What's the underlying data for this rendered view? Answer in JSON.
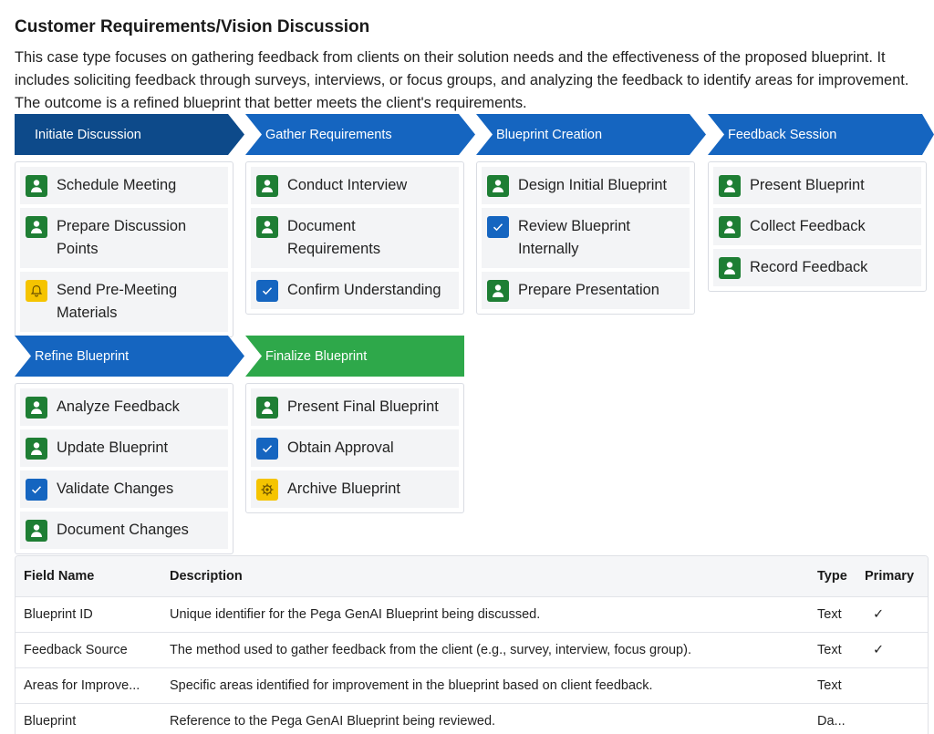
{
  "page": {
    "title": "Customer Requirements/Vision Discussion",
    "description": "This case type focuses on gathering feedback from clients on their solution needs and the effectiveness of the proposed blueprint. It includes soliciting feedback through surveys, interviews, or focus groups, and analyzing the feedback to identify areas for improvement. The outcome is a refined blueprint that better meets the client's requirements."
  },
  "stages": [
    {
      "label": "Initiate Discussion",
      "color": "#0d4a8a",
      "tasks": [
        {
          "icon": "person-icon",
          "label": "Schedule Meeting"
        },
        {
          "icon": "person-icon",
          "label": "Prepare Discussion Points"
        },
        {
          "icon": "bell-icon",
          "label": "Send Pre-Meeting Materials"
        }
      ]
    },
    {
      "label": "Gather Requirements",
      "color": "#1565c0",
      "tasks": [
        {
          "icon": "person-icon",
          "label": "Conduct Interview"
        },
        {
          "icon": "person-icon",
          "label": "Document Requirements"
        },
        {
          "icon": "check-icon",
          "label": "Confirm Understanding"
        }
      ]
    },
    {
      "label": "Blueprint Creation",
      "color": "#1565c0",
      "tasks": [
        {
          "icon": "person-icon",
          "label": "Design Initial Blueprint"
        },
        {
          "icon": "check-icon",
          "label": "Review Blueprint Internally"
        },
        {
          "icon": "person-icon",
          "label": "Prepare Presentation"
        }
      ]
    },
    {
      "label": "Feedback Session",
      "color": "#1565c0",
      "tasks": [
        {
          "icon": "person-icon",
          "label": "Present Blueprint"
        },
        {
          "icon": "person-icon",
          "label": "Collect Feedback"
        },
        {
          "icon": "person-icon",
          "label": "Record Feedback"
        }
      ]
    },
    {
      "label": "Refine Blueprint",
      "color": "#1565c0",
      "tasks": [
        {
          "icon": "person-icon",
          "label": "Analyze Feedback"
        },
        {
          "icon": "person-icon",
          "label": "Update Blueprint"
        },
        {
          "icon": "check-icon",
          "label": "Validate Changes"
        },
        {
          "icon": "person-icon",
          "label": "Document Changes"
        }
      ]
    },
    {
      "label": "Finalize Blueprint",
      "color": "#2ea84a",
      "tasks": [
        {
          "icon": "person-icon",
          "label": "Present Final Blueprint"
        },
        {
          "icon": "check-icon",
          "label": "Obtain Approval"
        },
        {
          "icon": "gear-icon",
          "label": "Archive Blueprint"
        }
      ]
    }
  ],
  "table": {
    "headers": [
      "Field Name",
      "Description",
      "Type",
      "Primary"
    ],
    "rows": [
      {
        "field": "Blueprint ID",
        "description": "Unique identifier for the Pega GenAI Blueprint being discussed.",
        "type": "Text",
        "primary": "✓"
      },
      {
        "field": "Feedback Source",
        "description": "The method used to gather feedback from the client (e.g., survey, interview, focus group).",
        "type": "Text",
        "primary": "✓"
      },
      {
        "field": "Areas for Improve...",
        "description": "Specific areas identified for improvement in the blueprint based on client feedback.",
        "type": "Text",
        "primary": ""
      },
      {
        "field": "Blueprint",
        "description": "Reference to the Pega GenAI Blueprint being reviewed.",
        "type": "Da...",
        "primary": ""
      }
    ]
  }
}
